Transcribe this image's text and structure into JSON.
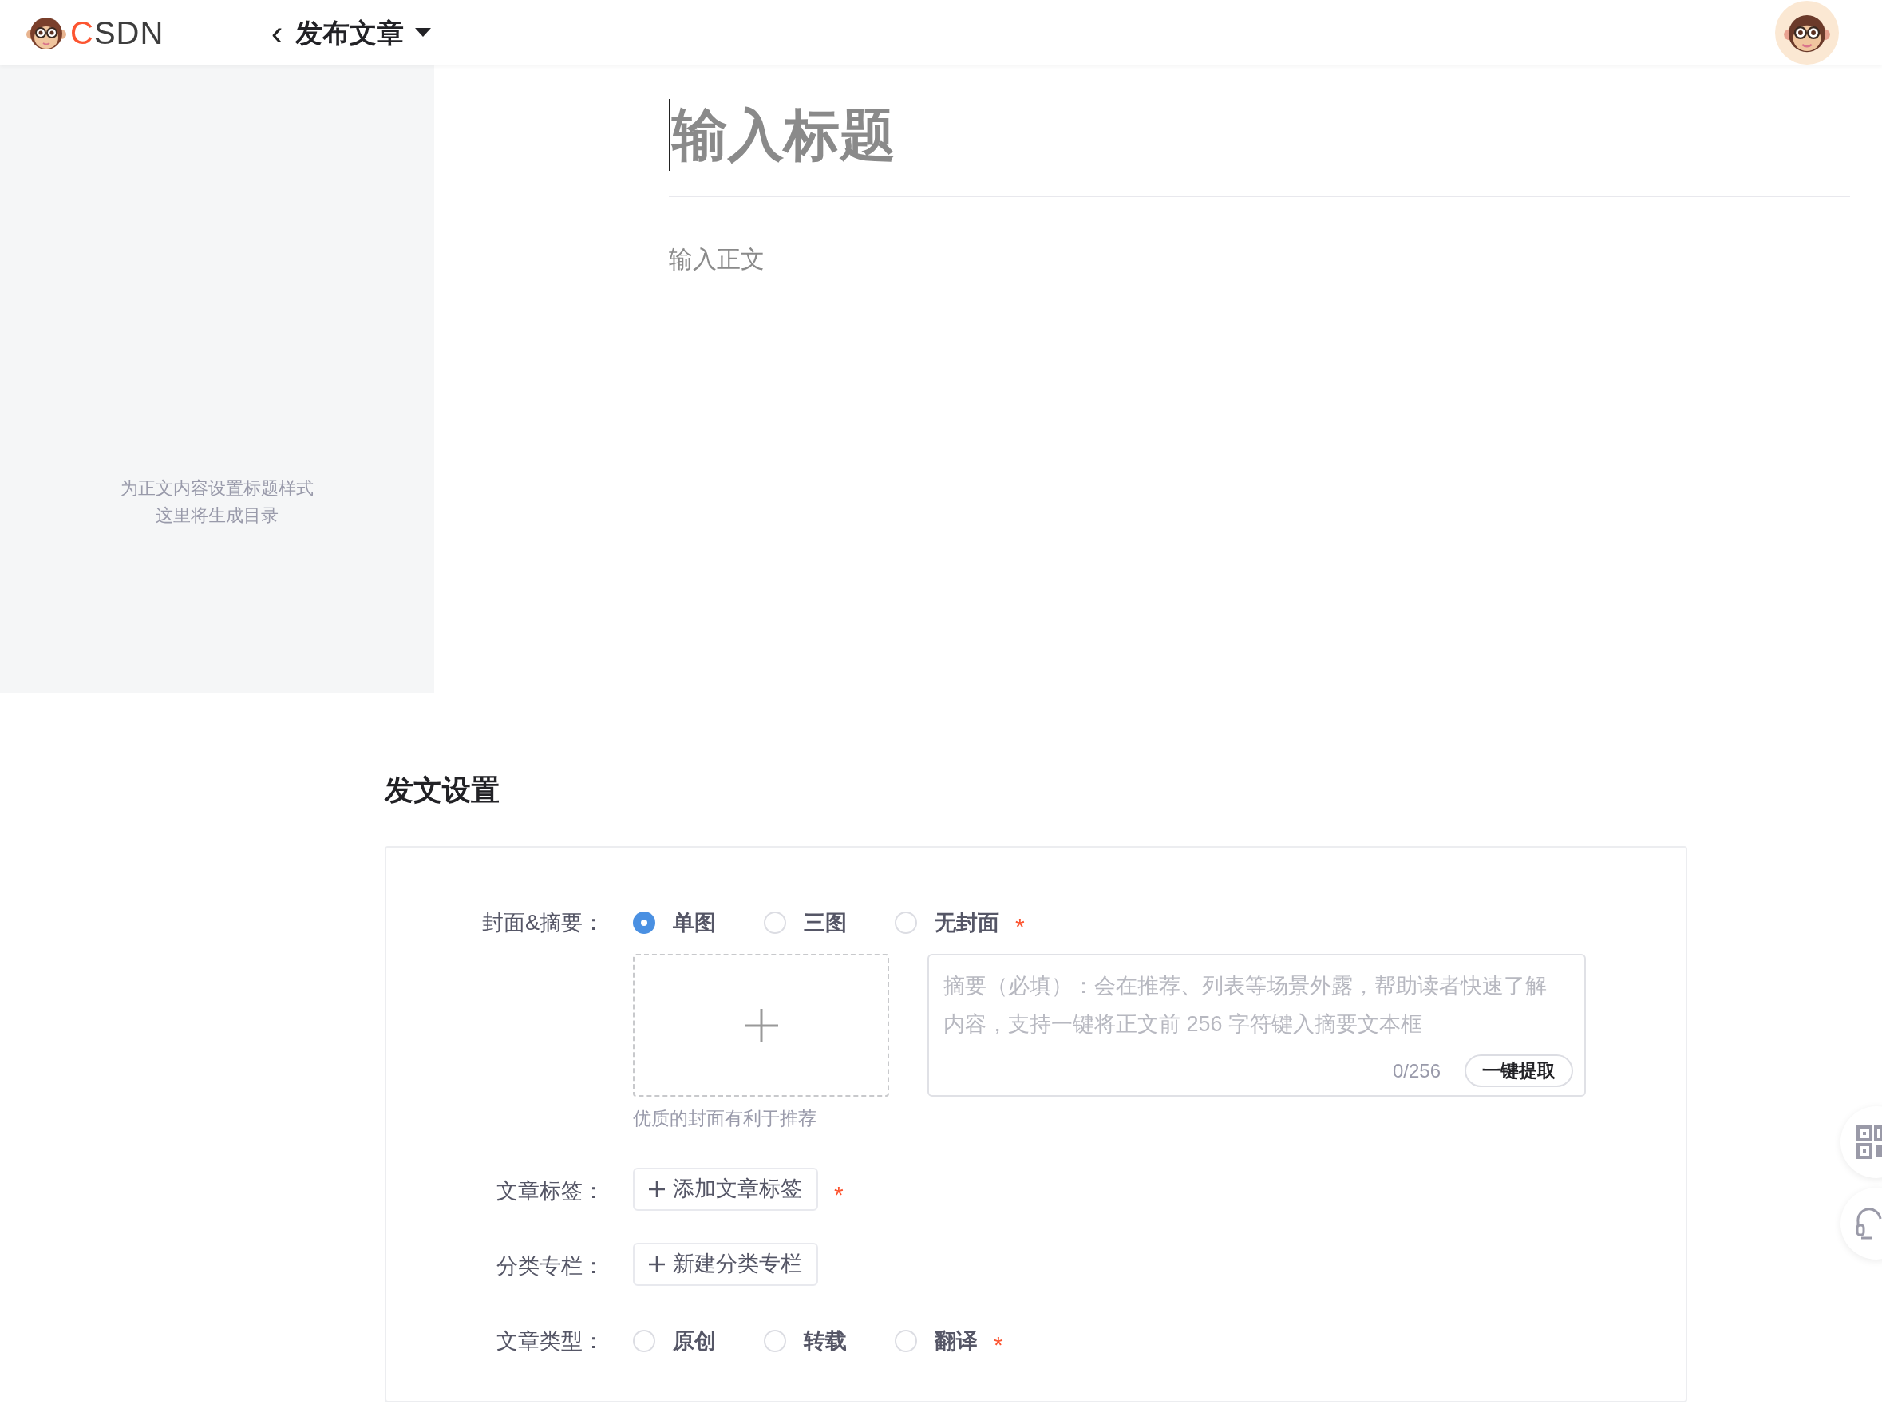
{
  "header": {
    "logo_text": "CSDN",
    "back": "‹",
    "title": "发布文章"
  },
  "sidebar": {
    "hint_lines": [
      "为正文内容设置标题样式",
      "这里将生成目录"
    ]
  },
  "editor": {
    "title_placeholder": "输入标题",
    "body_placeholder": "输入正文"
  },
  "settings": {
    "heading": "发文设置",
    "rows": [
      {
        "kind": "cover",
        "label": "封面&摘要：",
        "required_mark": "*",
        "options": [
          {
            "label": "单图",
            "selected": true
          },
          {
            "label": "三图",
            "selected": false
          },
          {
            "label": "无封面",
            "selected": false
          }
        ],
        "upload_hint": "优质的封面有利于推荐",
        "summary": {
          "placeholder": "摘要（必填）：会在推荐、列表等场景外露，帮助读者快速了解内容，支持一键将正文前 256 字符键入摘要文本框",
          "count": "0/256",
          "button": "一键提取"
        }
      },
      {
        "kind": "button",
        "label": "文章标签：",
        "required_mark": "*",
        "button": "添加文章标签"
      },
      {
        "kind": "button",
        "label": "分类专栏：",
        "button": "新建分类专栏"
      },
      {
        "kind": "radio",
        "label": "文章类型：",
        "required_mark": "*",
        "options": [
          {
            "label": "原创",
            "selected": false
          },
          {
            "label": "转载",
            "selected": false
          },
          {
            "label": "翻译",
            "selected": false
          }
        ]
      }
    ]
  }
}
